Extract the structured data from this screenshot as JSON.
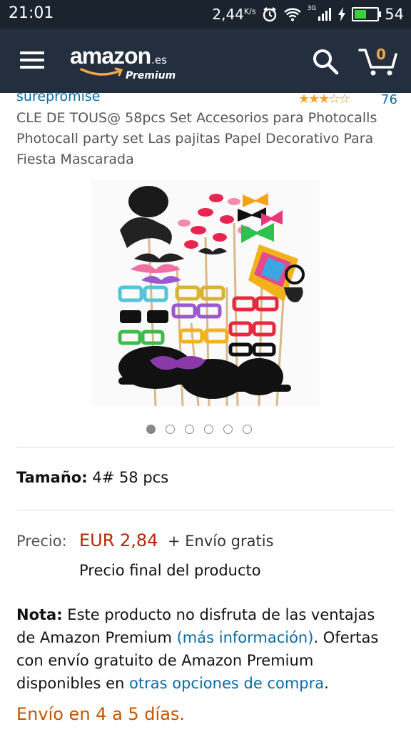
{
  "status_bar": {
    "time": "21:01",
    "speed": "2,44",
    "speed_unit": "K/s",
    "network": "3G",
    "battery": "54",
    "battery_level_pct": 54
  },
  "header": {
    "logo_text": "amazon",
    "logo_suffix": ".es",
    "logo_premium": "Premium",
    "cart_count": "0",
    "icons": [
      "menu-icon",
      "search-icon",
      "cart-icon"
    ]
  },
  "product": {
    "seller": "surepromise",
    "rating_stars": 3,
    "rating_max": 5,
    "rating_count": "76",
    "title": "CLE DE TOUS@ 58pcs Set Accesorios para Photocalls Photocall party set Las pajitas Papel Decorativo Para Fiesta Mascarada",
    "image_count": 6,
    "active_image_index": 0,
    "size_label": "Tamaño:",
    "size_value": "4# 58 pcs",
    "price_label": "Precio:",
    "price_value": "EUR 2,84",
    "shipping_text": "+ Envío gratis",
    "final_price_text": "Precio final del producto",
    "note_label": "Nota:",
    "note_text_1": " Este producto no disfruta de las ventajas de Amazon Premium ",
    "note_link_1": "(más información)",
    "note_text_2": ". Ofertas con envío gratuito de Amazon Premium disponibles en ",
    "note_link_2": "otras opciones de compra",
    "note_text_3": ".",
    "delivery": "Envío en 4 a 5 días."
  },
  "colors": {
    "header_bg": "#232f3e",
    "status_bg": "#1b242e",
    "link": "#0a6aa1",
    "price": "#b12704",
    "delivery": "#c45500",
    "star": "#f2a429",
    "cart_count": "#f3a847"
  }
}
